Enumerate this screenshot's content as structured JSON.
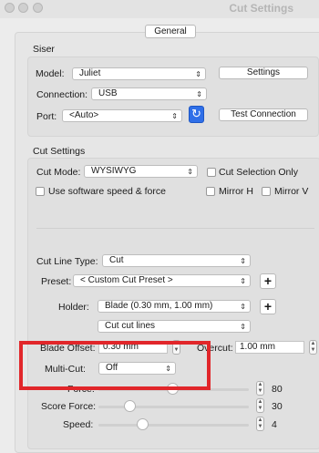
{
  "window": {
    "title": "Cut Settings"
  },
  "tabs": {
    "general": "General"
  },
  "siser": {
    "title": "Siser",
    "model_label": "Model:",
    "model_value": "Juliet",
    "settings_button": "Settings",
    "connection_label": "Connection:",
    "connection_value": "USB",
    "port_label": "Port:",
    "port_value": "<Auto>",
    "test_connection_button": "Test Connection"
  },
  "cut_settings": {
    "title": "Cut Settings",
    "cut_mode_label": "Cut Mode:",
    "cut_mode_value": "WYSIWYG",
    "cut_selection_only": "Cut Selection Only",
    "use_software_speed": "Use software speed & force",
    "mirror_h": "Mirror H",
    "mirror_v": "Mirror V",
    "cut_line_type_label": "Cut Line Type:",
    "cut_line_type_value": "Cut",
    "preset_label": "Preset:",
    "preset_value": "< Custom Cut Preset >",
    "holder_label": "Holder:",
    "holder_value": "Blade (0.30 mm, 1.00 mm)",
    "cut_lines_value": "Cut cut lines",
    "blade_offset_label": "Blade Offset:",
    "blade_offset_value": "0.30 mm",
    "overcut_label": "Overcut:",
    "overcut_value": "1.00 mm",
    "multi_cut_label": "Multi-Cut:",
    "multi_cut_value": "Off",
    "force_label": "Force:",
    "force_value": "80",
    "score_force_label": "Score Force:",
    "score_force_value": "30",
    "speed_label": "Speed:",
    "speed_value": "4"
  },
  "colors": {
    "accent": "#2f6fe8",
    "highlight": "#e1262a"
  },
  "icons": {
    "refresh": "refresh-icon",
    "plus": "plus-icon",
    "popup": "chevron-updown-icon"
  }
}
